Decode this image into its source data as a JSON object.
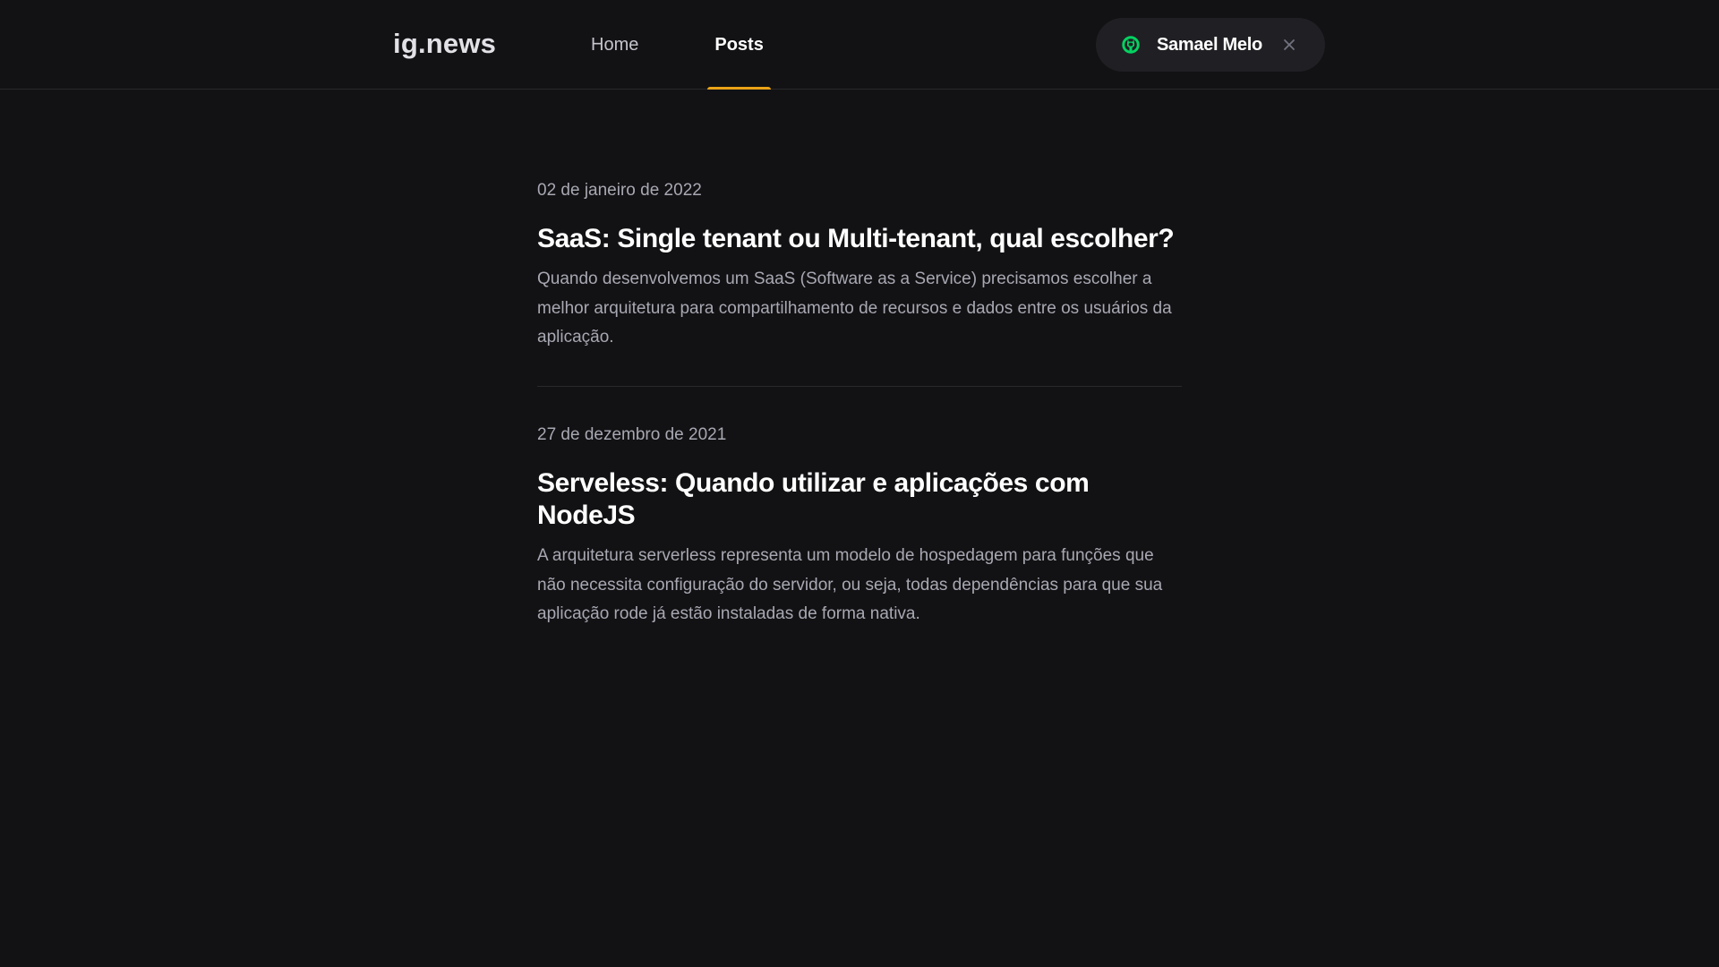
{
  "header": {
    "logo": "ig.news",
    "nav": [
      {
        "label": "Home",
        "active": false
      },
      {
        "label": "Posts",
        "active": true
      }
    ],
    "user": {
      "name": "Samael Melo",
      "icon": "github-icon",
      "icon_color": "#04d361",
      "close_icon": "close-icon"
    },
    "active_underline_color": "#eba417"
  },
  "posts": [
    {
      "date": "02 de janeiro de 2022",
      "title": "SaaS: Single tenant ou Multi-tenant, qual escolher?",
      "excerpt": "Quando desenvolvemos um SaaS (Software as a Service) precisamos escolher a melhor arquitetura para compartilhamento de recursos e dados entre os usuários da aplicação."
    },
    {
      "date": "27 de dezembro de 2021",
      "title": "Serveless: Quando utilizar e aplicações com NodeJS",
      "excerpt": "A arquitetura serverless representa um modelo de hospedagem para funções que não necessita configuração do servidor, ou seja, todas dependências para que sua aplicação rode já estão instaladas de forma nativa."
    }
  ]
}
